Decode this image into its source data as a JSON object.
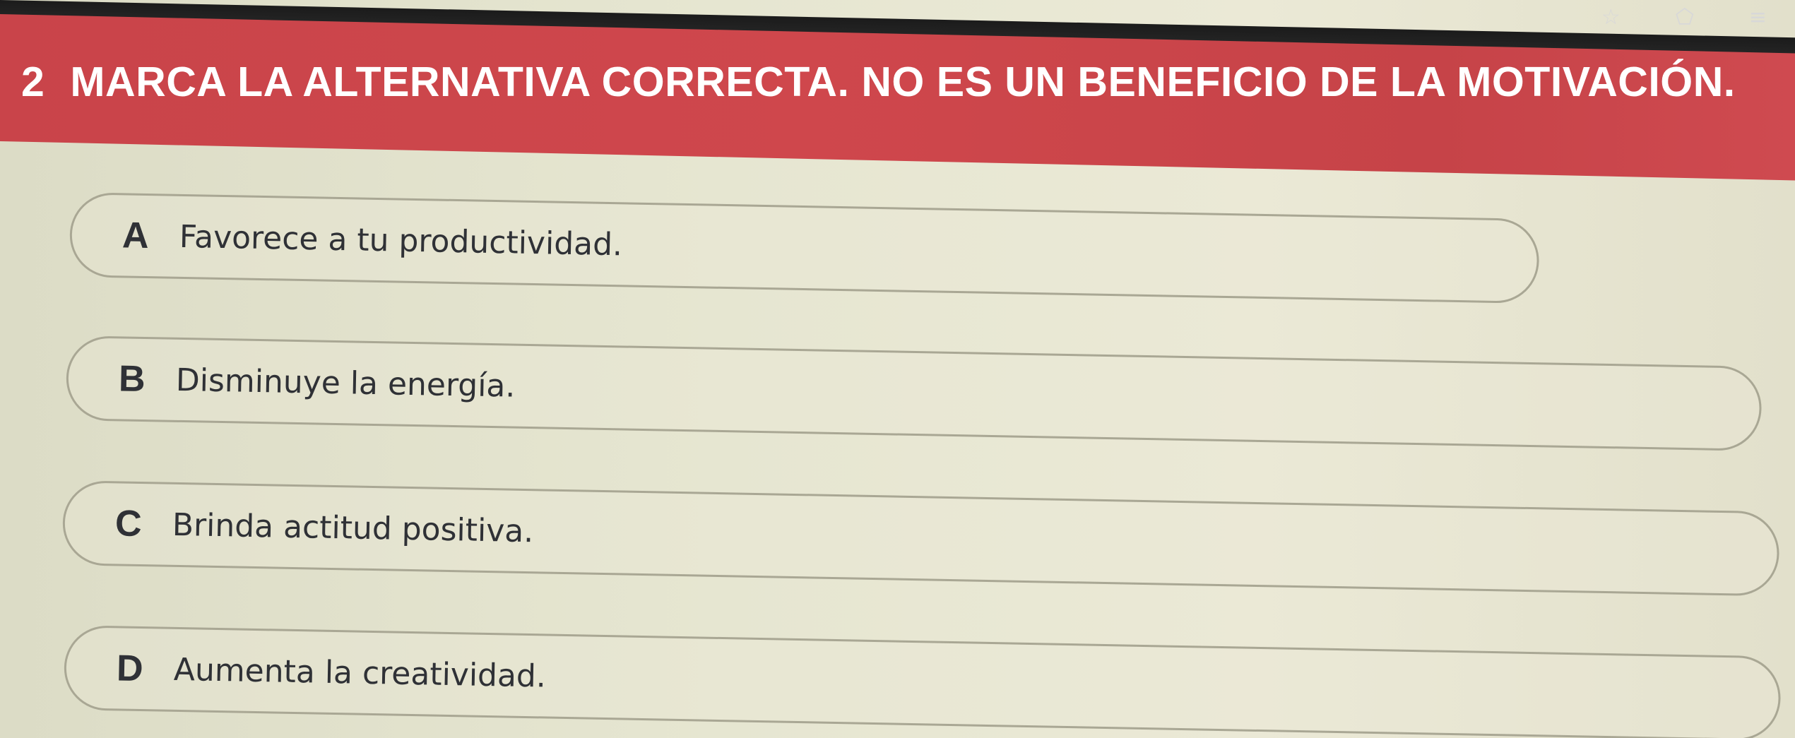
{
  "browser": {
    "icons": [
      "star-icon",
      "extension-icon",
      "reading-list-icon"
    ],
    "icon_glyphs": [
      "☆",
      "⬠",
      "≡"
    ]
  },
  "question": {
    "number": "2",
    "text": "MARCA LA ALTERNATIVA CORRECTA. NO ES UN BENEFICIO DE LA MOTIVACIÓN."
  },
  "options": [
    {
      "letter": "A",
      "text": "Favorece a tu productividad."
    },
    {
      "letter": "B",
      "text": "Disminuye la energía."
    },
    {
      "letter": "C",
      "text": "Brinda actitud positiva."
    },
    {
      "letter": "D",
      "text": "Aumenta la creatividad."
    }
  ],
  "colors": {
    "banner": "#cf474c",
    "background": "#e6e6d1",
    "text_dark": "#2f3136",
    "option_border": "#a9a794"
  }
}
